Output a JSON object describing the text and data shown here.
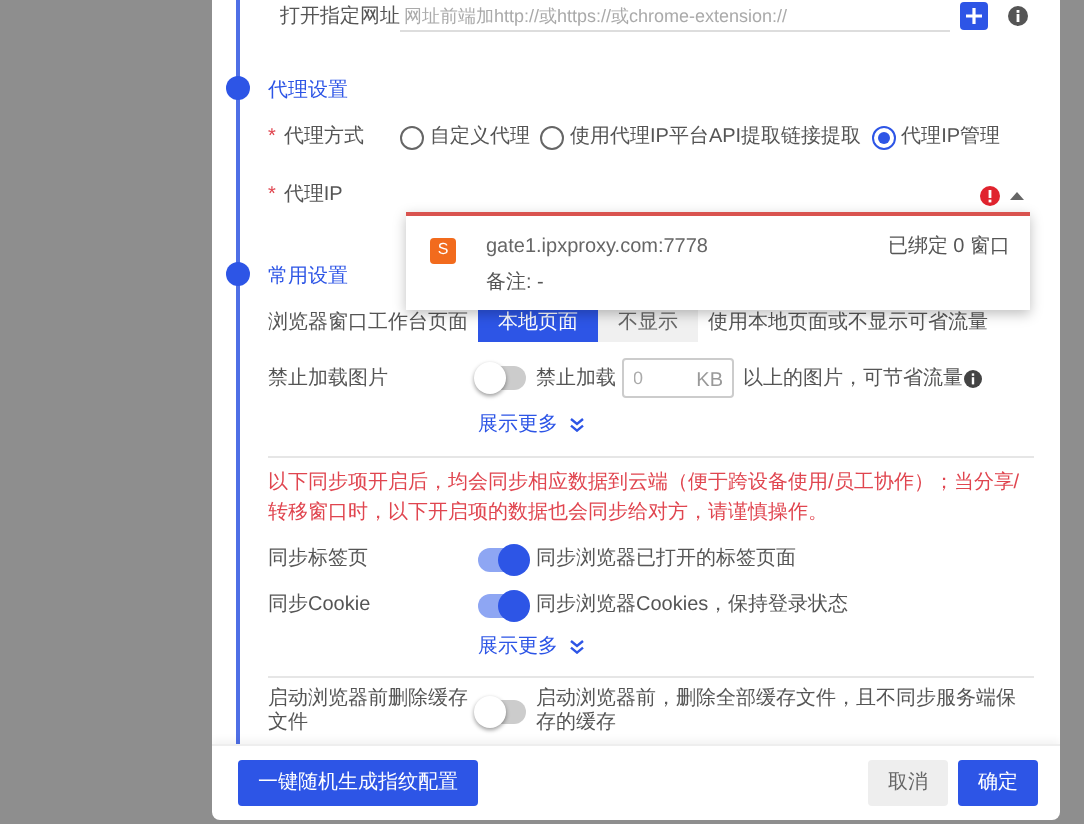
{
  "url_row": {
    "label": "打开指定网址",
    "placeholder": "网址前端加http://或https://或chrome-extension://"
  },
  "proxy": {
    "title": "代理设置",
    "mode": {
      "mark": "*",
      "label": "代理方式",
      "options": [
        {
          "label": "自定义代理",
          "selected": false
        },
        {
          "label": "使用代理IP平台API提取链接提取",
          "selected": false
        },
        {
          "label": "代理IP管理",
          "selected": true
        }
      ]
    },
    "ip": {
      "mark": "*",
      "label": "代理IP",
      "error": true,
      "expanded": true,
      "items": [
        {
          "badge": "S",
          "host": "gate1.ipxproxy.com:7778",
          "note": "备注: -",
          "bound": "已绑定 0 窗口"
        }
      ]
    }
  },
  "common": {
    "title": "常用设置",
    "workbench": {
      "label": "浏览器窗口工作台页面",
      "options": [
        {
          "label": "本地页面",
          "selected": true
        },
        {
          "label": "不显示",
          "selected": false
        }
      ],
      "hint": "使用本地页面或不显示可省流量"
    },
    "block_images": {
      "label": "禁止加载图片",
      "on": false,
      "prefix": "禁止加载",
      "placeholder": "0",
      "unit": "KB",
      "suffix": "以上的图片，可节省流量"
    },
    "show_more": "展示更多",
    "warning": "以下同步项开启后，均会同步相应数据到云端（便于跨设备使用/员工协作）；当分享/转移窗口时，以下开启项的数据也会同步给对方，请谨慎操作。",
    "syncs": [
      {
        "label": "同步标签页",
        "on": true,
        "hint": "同步浏览器已打开的标签页面"
      },
      {
        "label": "同步Cookie",
        "on": true,
        "hint": "同步浏览器Cookies，保持登录状态"
      }
    ],
    "show_more_2": "展示更多",
    "clear_cache": {
      "label": "启动浏览器前删除缓存文件",
      "on": false,
      "hint": "启动浏览器前，删除全部缓存文件，且不同步服务端保存的缓存"
    }
  },
  "footer": {
    "generate": "一键随机生成指纹配置",
    "cancel": "取消",
    "ok": "确定"
  }
}
